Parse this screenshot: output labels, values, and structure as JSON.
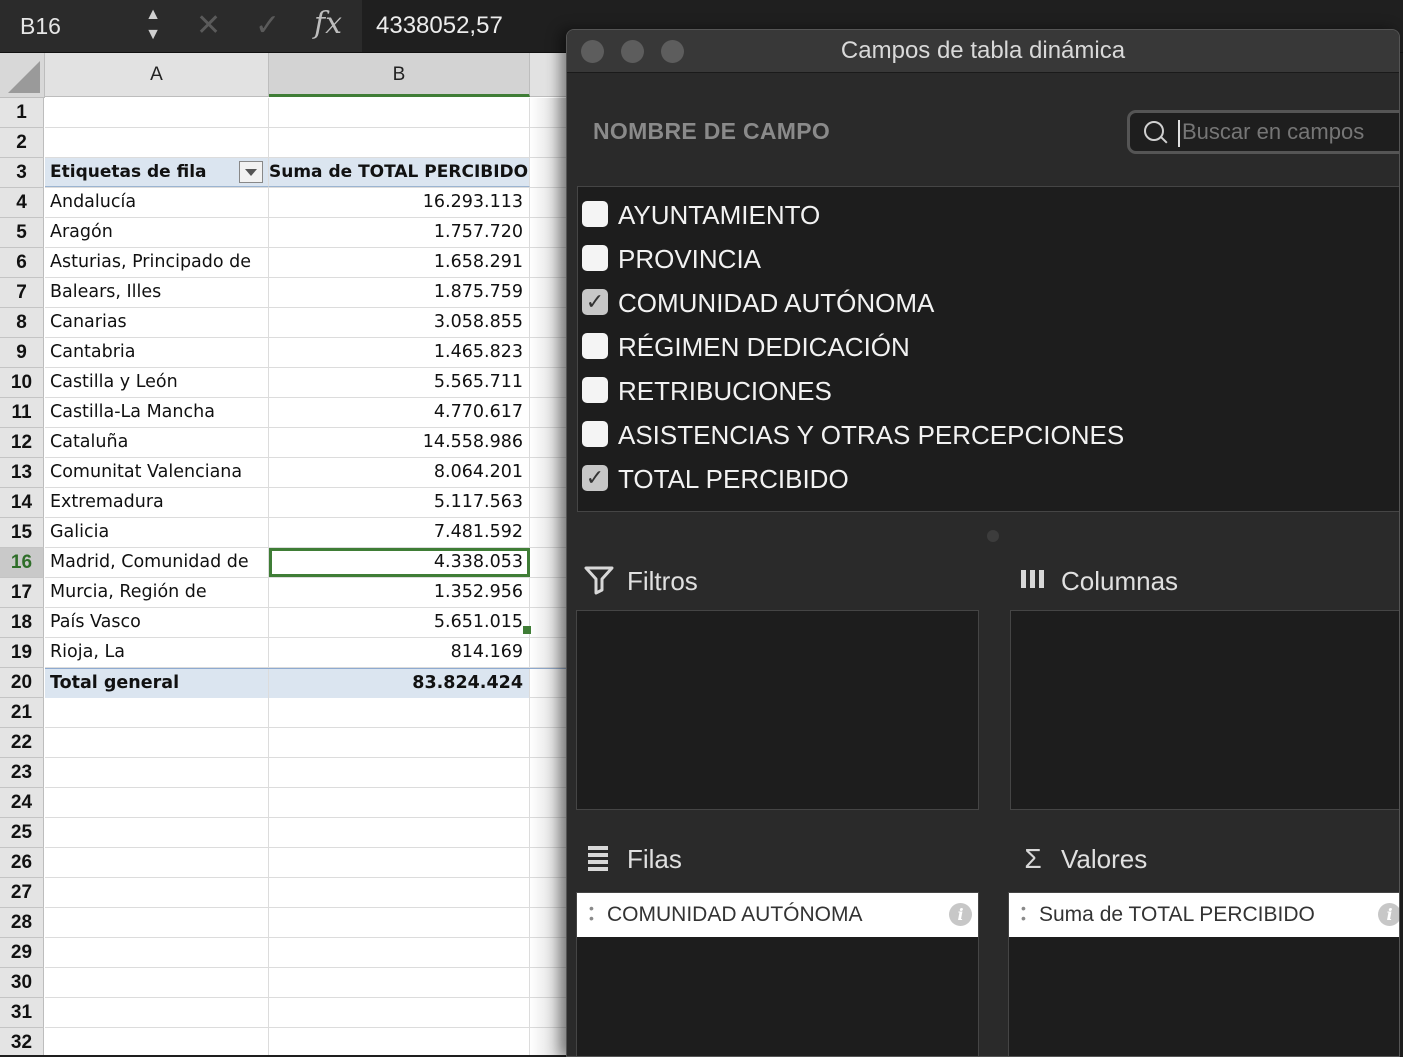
{
  "formula_bar": {
    "cell_ref": "B16",
    "formula": "4338052,57",
    "fx_label": "fx"
  },
  "sheet": {
    "columns": [
      "A",
      "B"
    ],
    "rows": [
      {
        "num": "1",
        "a": "",
        "b": ""
      },
      {
        "num": "2",
        "a": "",
        "b": ""
      },
      {
        "num": "3",
        "a": "Etiquetas de fila",
        "b": "Suma de TOTAL PERCIBIDO"
      },
      {
        "num": "4",
        "a": "Andalucía",
        "b": "16.293.113"
      },
      {
        "num": "5",
        "a": "Aragón",
        "b": "1.757.720"
      },
      {
        "num": "6",
        "a": "Asturias, Principado de",
        "b": "1.658.291"
      },
      {
        "num": "7",
        "a": "Balears, Illes",
        "b": "1.875.759"
      },
      {
        "num": "8",
        "a": "Canarias",
        "b": "3.058.855"
      },
      {
        "num": "9",
        "a": "Cantabria",
        "b": "1.465.823"
      },
      {
        "num": "10",
        "a": "Castilla y León",
        "b": "5.565.711"
      },
      {
        "num": "11",
        "a": "Castilla-La Mancha",
        "b": "4.770.617"
      },
      {
        "num": "12",
        "a": "Cataluña",
        "b": "14.558.986"
      },
      {
        "num": "13",
        "a": "Comunitat Valenciana",
        "b": "8.064.201"
      },
      {
        "num": "14",
        "a": "Extremadura",
        "b": "5.117.563"
      },
      {
        "num": "15",
        "a": "Galicia",
        "b": "7.481.592"
      },
      {
        "num": "16",
        "a": "Madrid, Comunidad de",
        "b": "4.338.053"
      },
      {
        "num": "17",
        "a": "Murcia, Región de",
        "b": "1.352.956"
      },
      {
        "num": "18",
        "a": "País Vasco",
        "b": "5.651.015"
      },
      {
        "num": "19",
        "a": "Rioja, La",
        "b": "814.169"
      },
      {
        "num": "20",
        "a": "Total general",
        "b": "83.824.424"
      },
      {
        "num": "21",
        "a": "",
        "b": ""
      },
      {
        "num": "22",
        "a": "",
        "b": ""
      },
      {
        "num": "23",
        "a": "",
        "b": ""
      },
      {
        "num": "24",
        "a": "",
        "b": ""
      },
      {
        "num": "25",
        "a": "",
        "b": ""
      },
      {
        "num": "26",
        "a": "",
        "b": ""
      },
      {
        "num": "27",
        "a": "",
        "b": ""
      },
      {
        "num": "28",
        "a": "",
        "b": ""
      },
      {
        "num": "29",
        "a": "",
        "b": ""
      },
      {
        "num": "30",
        "a": "",
        "b": ""
      },
      {
        "num": "31",
        "a": "",
        "b": ""
      },
      {
        "num": "32",
        "a": "",
        "b": ""
      }
    ]
  },
  "panel": {
    "title": "Campos de tabla dinámica",
    "field_name_label": "NOMBRE DE CAMPO",
    "search_placeholder": "Buscar en campos",
    "fields": [
      {
        "label": "AYUNTAMIENTO",
        "checked": false
      },
      {
        "label": "PROVINCIA",
        "checked": false
      },
      {
        "label": "COMUNIDAD AUTÓNOMA",
        "checked": true
      },
      {
        "label": "RÉGIMEN DEDICACIÓN",
        "checked": false
      },
      {
        "label": "RETRIBUCIONES",
        "checked": false
      },
      {
        "label": "ASISTENCIAS Y OTRAS PERCEPCIONES",
        "checked": false
      },
      {
        "label": "TOTAL PERCIBIDO",
        "checked": true
      }
    ],
    "areas": {
      "filters": {
        "label": "Filtros",
        "icon": "funnel-icon"
      },
      "columns": {
        "label": "Columnas",
        "icon": "columns-icon"
      },
      "rows": {
        "label": "Filas",
        "icon": "rows-icon",
        "item": "COMUNIDAD AUTÓNOMA"
      },
      "values": {
        "label": "Valores",
        "icon": "sigma-icon",
        "item": "Suma de TOTAL PERCIBIDO"
      }
    }
  },
  "colors": {
    "selection": "#3f7d36",
    "pivot_header": "#dbe5f0",
    "panel_bg": "#2a2a2a"
  }
}
